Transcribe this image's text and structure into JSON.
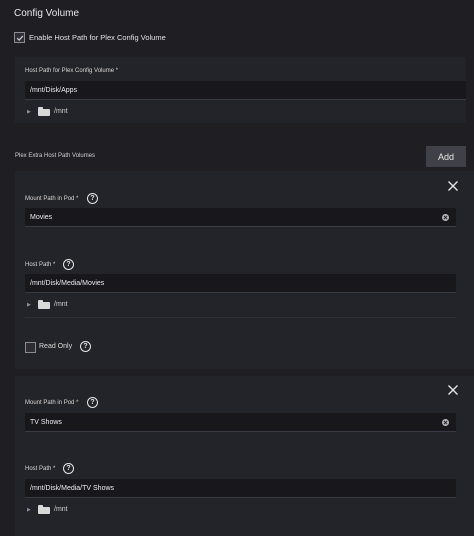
{
  "config_volume": {
    "title": "Config Volume",
    "enable_label": "Enable Host Path for Plex Config Volume",
    "enable_checked": true,
    "host_path_label": "Host Path for Plex Config Volume *",
    "host_path_value": "/mnt/Disk/Apps",
    "tree_root": "/mnt"
  },
  "extra_volumes": {
    "title": "Plex Extra Host Path Volumes",
    "add_label": "Add",
    "items": [
      {
        "mount_label": "Mount Path in Pod *",
        "mount_value": "Movies",
        "host_label": "Host Path *",
        "host_value": "/mnt/Disk/Media/Movies",
        "tree_root": "/mnt",
        "readonly_label": "Read Only",
        "readonly_checked": false
      },
      {
        "mount_label": "Mount Path in Pod *",
        "mount_value": "TV Shows",
        "host_label": "Host Path *",
        "host_value": "/mnt/Disk/Media/TV Shows",
        "tree_root": "/mnt"
      }
    ]
  },
  "icons": {
    "check": "check-icon",
    "help": "question-circle-icon",
    "close": "close-icon",
    "clear": "clear-circle-icon",
    "folder": "folder-icon",
    "expand": "triangle-right-icon"
  },
  "colors": {
    "background": "#1e1e23",
    "panel": "#23232a",
    "input": "#17171c",
    "button": "#404048"
  }
}
